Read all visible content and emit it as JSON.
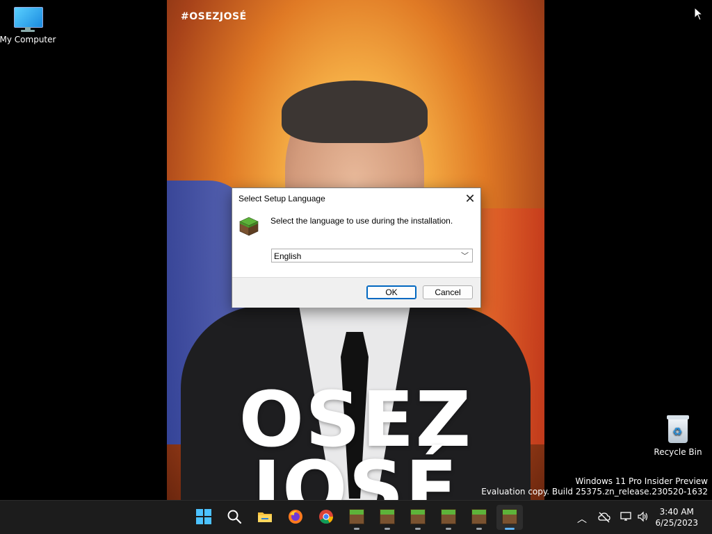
{
  "desktop": {
    "icons": [
      {
        "label": "My Computer",
        "icon": "computer-icon"
      },
      {
        "label": "Recycle Bin",
        "icon": "recycle-bin-icon"
      }
    ],
    "watermark": {
      "line1": "Windows 11 Pro Insider Preview",
      "line2": "Evaluation copy. Build 25375.zn_release.230520-1632"
    }
  },
  "wallpaper": {
    "hashtag": "#OSEZJOSÉ",
    "line1": "OSEZ",
    "line2": "JOSÉ"
  },
  "dialog": {
    "title": "Select Setup Language",
    "message": "Select the language to use during the installation.",
    "language_selected": "English",
    "ok_label": "OK",
    "cancel_label": "Cancel",
    "icon": "minecraft-grass-block-icon"
  },
  "taskbar": {
    "apps": [
      "start",
      "search",
      "file-explorer",
      "firefox",
      "chrome",
      "minecraft-setup",
      "minecraft-setup",
      "minecraft-setup",
      "minecraft-setup",
      "minecraft-setup",
      "minecraft-setup"
    ],
    "active_index": 10,
    "clock": {
      "time": "3:40 AM",
      "date": "6/25/2023"
    }
  },
  "colors": {
    "accent": "#0067c0",
    "taskbar": "#1c1c1c"
  }
}
